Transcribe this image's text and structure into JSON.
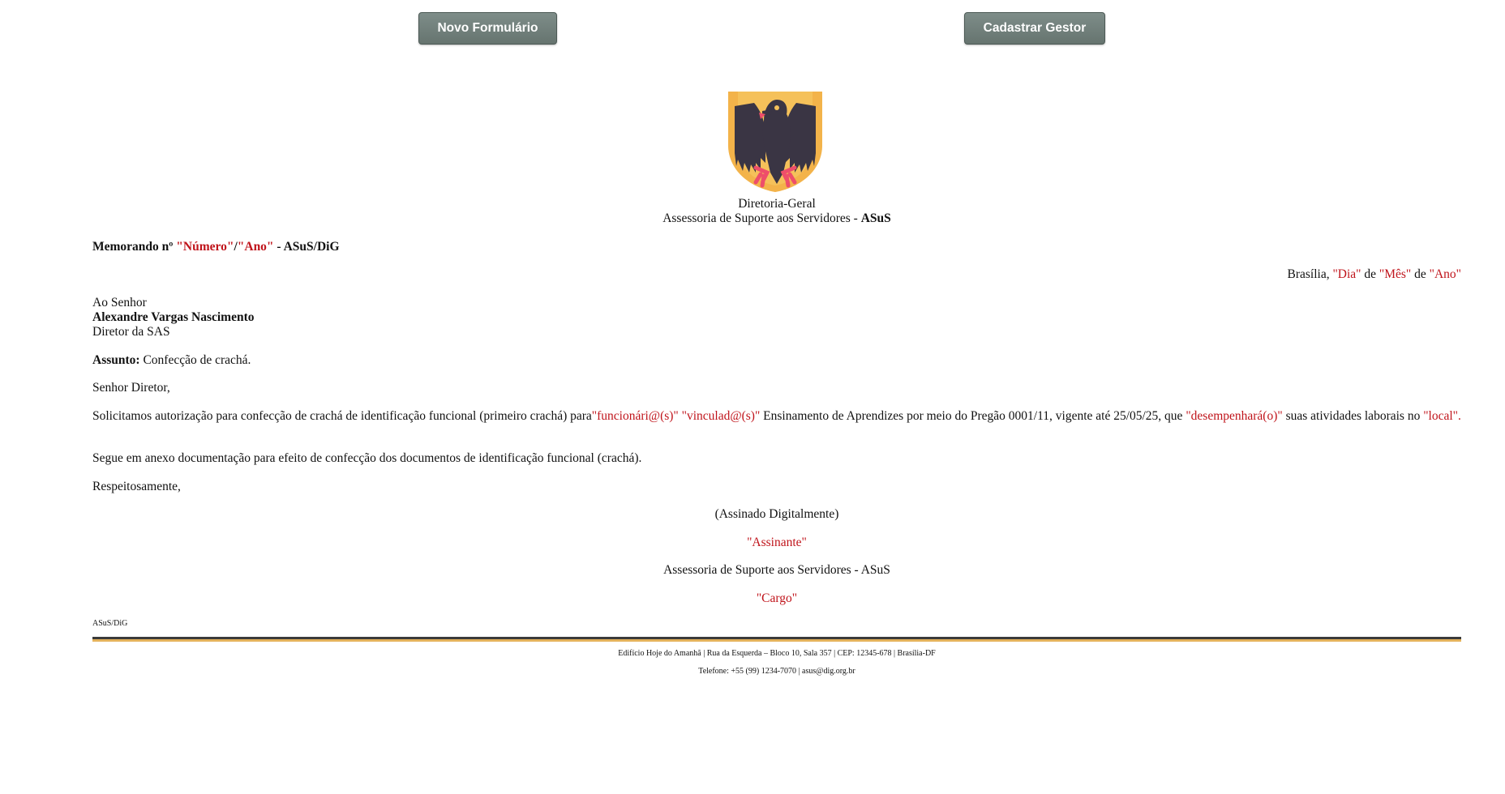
{
  "toolbar": {
    "new_form_label": "Novo Formulário",
    "register_manager_label": "Cadastrar Gestor"
  },
  "header": {
    "logo_icon": "eagle-crest-icon",
    "directorate": "Diretoria-Geral",
    "department_prefix": "Assessoria de Suporte aos Servidores - ",
    "department_acronym": "ASuS"
  },
  "memo": {
    "prefix": "Memorando nº ",
    "number_placeholder": "\"Número\"",
    "separator": "/",
    "year_placeholder": "\"Ano\"",
    "suffix": " - ASuS/DiG"
  },
  "date_line": {
    "city": "Brasília, ",
    "day": "\"Dia\"",
    "de1": " de ",
    "month": "\"Mês\"",
    "de2": " de ",
    "year": "\"Ano\""
  },
  "addressee": {
    "salutation": "Ao Senhor",
    "name": "Alexandre Vargas Nascimento",
    "role": "Diretor da SAS"
  },
  "subject": {
    "label": "Assunto:",
    "text": " Confecção de crachá."
  },
  "greeting": "Senhor Diretor,",
  "body": {
    "part1": "Solicitamos autorização para confecção de crachá de identificação funcional (primeiro crachá) para",
    "employee": "\"funcionári@(s)\" \"vinculad@(s)\"",
    "part2": " Ensinamento de Aprendizes por meio do Pregão 0001/11, vigente até 25/05/25, que ",
    "perform": "\"desempenhará(o)\"",
    "part3": " suas atividades laborais no ",
    "local": "\"local\"",
    "part4": "."
  },
  "paragraph2": "Segue em anexo documentação para efeito de confecção dos documentos de identificação funcional (crachá).",
  "closing": "Respeitosamente,",
  "signature": {
    "digital": "(Assinado Digitalmente)",
    "signer": "\"Assinante\"",
    "organization": "Assessoria de Suporte aos Servidores - ASuS",
    "position": "\"Cargo\""
  },
  "footer": {
    "code": "ASuS/DiG",
    "address": "Edifício Hoje do Amanhã | Rua da Esquerda – Bloco 10, Sala 357 | CEP: 12345-678 | Brasília-DF",
    "phone": "Telefone: +55 (99) 1234-7070 | asus@dig.org.br"
  },
  "colors": {
    "placeholder": "#c0141b",
    "button": "#6f7e79",
    "rule_dark": "#3a3a3a",
    "rule_gold": "#e4b25c",
    "crest_shield": "#f5c15a",
    "crest_eagle": "#3a3544",
    "crest_accent": "#ee4e6a"
  }
}
